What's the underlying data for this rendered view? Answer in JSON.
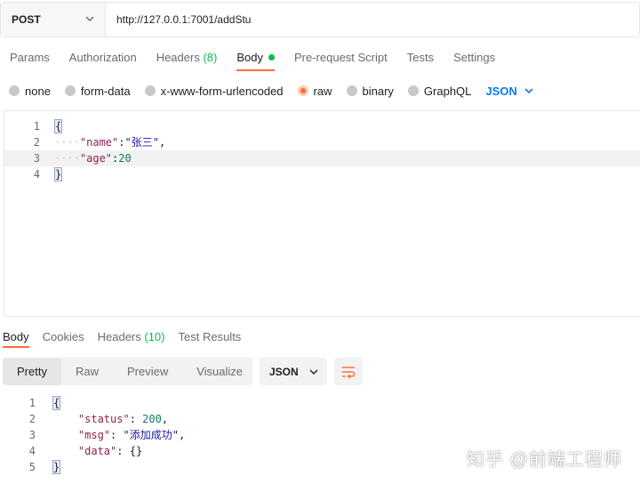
{
  "request": {
    "method": "POST",
    "url": "http://127.0.0.1:7001/addStu"
  },
  "request_tabs": [
    {
      "label": "Params"
    },
    {
      "label": "Authorization"
    },
    {
      "label": "Headers",
      "count": "(8)"
    },
    {
      "label": "Body"
    },
    {
      "label": "Pre-request Script"
    },
    {
      "label": "Tests"
    },
    {
      "label": "Settings"
    }
  ],
  "body_types": [
    "none",
    "form-data",
    "x-www-form-urlencoded",
    "raw",
    "binary",
    "GraphQL"
  ],
  "body_format": "JSON",
  "request_body": {
    "line_numbers": [
      "1",
      "2",
      "3",
      "4"
    ],
    "open_brace": "{",
    "close_brace": "}",
    "ws": "····",
    "name_key": "\"name\"",
    "name_value": "\"张三\"",
    "age_key": "\"age\"",
    "age_value": "20"
  },
  "response_tabs": [
    {
      "label": "Body"
    },
    {
      "label": "Cookies"
    },
    {
      "label": "Headers",
      "count": "(10)"
    },
    {
      "label": "Test Results"
    }
  ],
  "view_modes": [
    "Pretty",
    "Raw",
    "Preview",
    "Visualize"
  ],
  "response_format": "JSON",
  "response_body": {
    "line_numbers": [
      "1",
      "2",
      "3",
      "4",
      "5"
    ],
    "open_brace": "{",
    "close_brace": "}",
    "status_key": "\"status\"",
    "status_value": "200",
    "msg_key": "\"msg\"",
    "msg_value": "\"添加成功\"",
    "data_key": "\"data\"",
    "data_value": "{}"
  },
  "watermark": "知乎 @前端工程师",
  "colors": {
    "accent": "#ff6c37",
    "green": "#0cbb52",
    "blue": "#097bed"
  }
}
